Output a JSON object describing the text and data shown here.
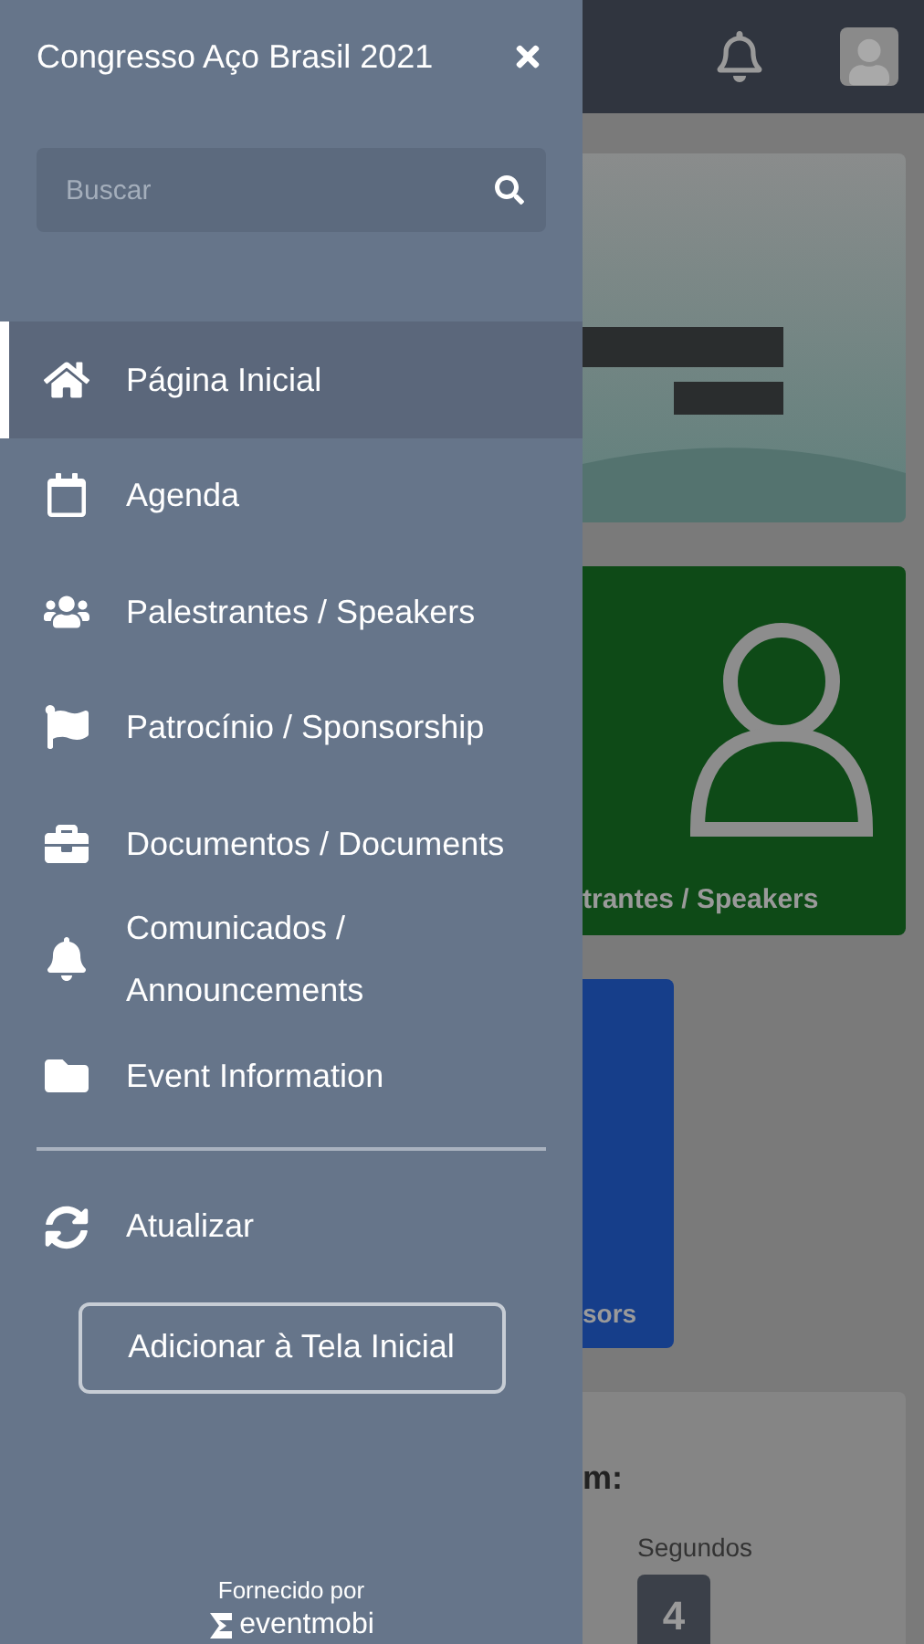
{
  "drawer": {
    "title": "Congresso Aço Brasil 2021",
    "search": {
      "placeholder": "Buscar"
    },
    "items": [
      {
        "label": "Página Inicial",
        "selected": true
      },
      {
        "label": "Agenda",
        "selected": false
      },
      {
        "label": "Palestrantes / Speakers",
        "selected": false
      },
      {
        "label": "Patrocínio / Sponsorship",
        "selected": false
      },
      {
        "label": "Documentos / Documents",
        "selected": false
      },
      {
        "label": "Comunicados / Announcements",
        "selected": false
      },
      {
        "label": "Event Information",
        "selected": false
      }
    ],
    "refresh": "Atualizar",
    "add_button": "Adicionar à Tela Inicial",
    "footer": {
      "powered_by": "Fornecido por",
      "brand": "eventmobi"
    }
  },
  "page": {
    "speakers_tile": "trantes / Speakers",
    "sponsors_tile": "sors",
    "countdown": {
      "heading": "m:",
      "unit": "Segundos",
      "value": "4"
    }
  }
}
